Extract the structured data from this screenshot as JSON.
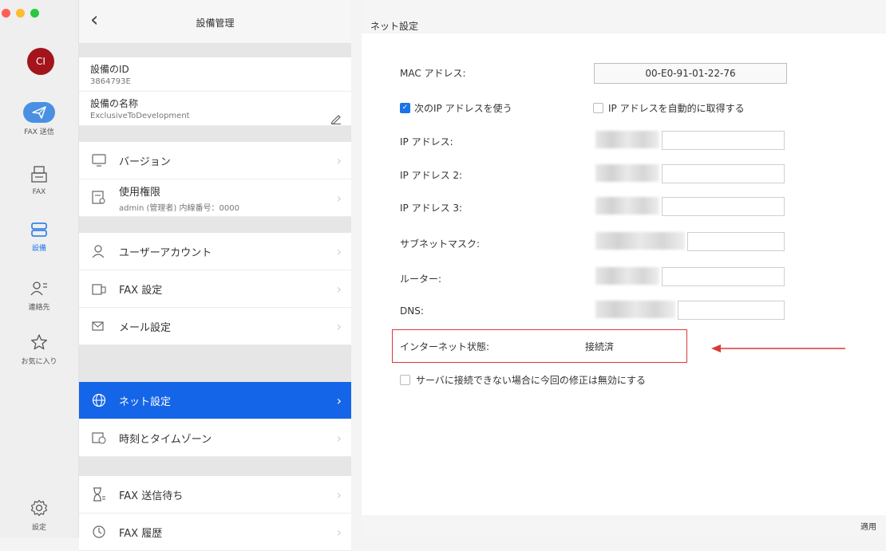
{
  "window": {
    "traffic_colors": [
      "#fe5f57",
      "#febc2e",
      "#28c840"
    ]
  },
  "rail": {
    "avatar": "CI",
    "items": [
      {
        "label": "FAX 送信",
        "icon": "paper-plane-icon"
      },
      {
        "label": "FAX",
        "icon": "fax-icon"
      },
      {
        "label": "設備",
        "icon": "device-icon"
      },
      {
        "label": "連絡先",
        "icon": "contacts-icon"
      },
      {
        "label": "お気に入り",
        "icon": "star-icon"
      },
      {
        "label": "設定",
        "icon": "gear-icon"
      }
    ]
  },
  "mid": {
    "title": "設備管理",
    "device_id_label": "設備のID",
    "device_id_value": "3864793E",
    "device_name_label": "設備の名称",
    "device_name_value": "ExclusiveToDevelopment",
    "menu": [
      {
        "label": "バージョン",
        "icon": "monitor-icon"
      },
      {
        "label": "使用権限",
        "sub": "admin (管理者)  内線番号：0000",
        "icon": "permission-icon"
      },
      {
        "label": "ユーザーアカウント",
        "icon": "user-account-icon"
      },
      {
        "label": "FAX 設定",
        "icon": "fax-settings-icon"
      },
      {
        "label": "メール設定",
        "icon": "mail-settings-icon"
      },
      {
        "label": "ネット設定",
        "icon": "globe-icon"
      },
      {
        "label": "時刻とタイムゾーン",
        "icon": "clock-icon"
      },
      {
        "label": "FAX 送信待ち",
        "icon": "hourglass-icon"
      },
      {
        "label": "FAX 履歴",
        "icon": "history-icon"
      }
    ]
  },
  "net": {
    "title": "ネット設定",
    "mac_label": "MAC アドレス:",
    "mac_value": "00-E0-91-01-22-76",
    "use_ip_label": "次のIP アドレスを使う",
    "auto_ip_label": "IP アドレスを自動的に取得する",
    "ip_label": "IP アドレス:",
    "ip2_label": "IP アドレス 2:",
    "ip3_label": "IP アドレス 3:",
    "subnet_label": "サブネットマスク:",
    "router_label": "ルーター:",
    "dns_label": "DNS:",
    "internet_label": "インターネット状態:",
    "internet_value": "接続済",
    "discard_label": "サーバに接続できない場合に今回の修正は無効にする",
    "apply_label": "適用",
    "highlight_color": "#d93a3a"
  }
}
